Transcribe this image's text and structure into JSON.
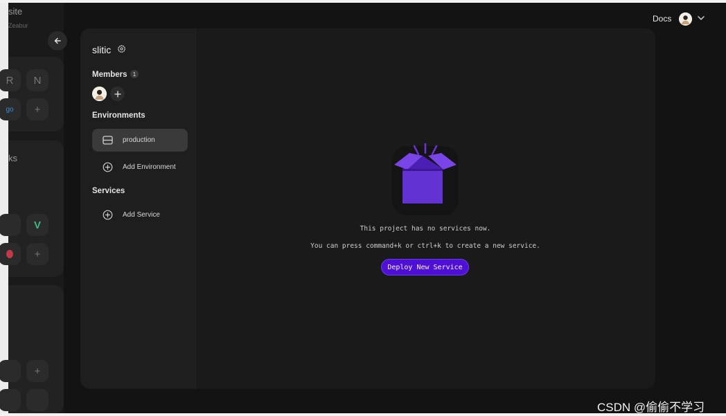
{
  "background": {
    "partial_site_label": "site",
    "partial_zeabur_label": "Zeabur",
    "partial_works_label": "ks",
    "tile_r": "R",
    "tile_n": "N",
    "tile_go": "go",
    "tile_v": "V",
    "tile_plus": "+"
  },
  "topbar": {
    "docs_label": "Docs"
  },
  "project": {
    "name": "slitic",
    "members_label": "Members",
    "members_count": "1",
    "environments_label": "Environments",
    "environments": [
      {
        "label": "production"
      }
    ],
    "add_environment_label": "Add Environment",
    "services_label": "Services",
    "add_service_label": "Add Service"
  },
  "empty_state": {
    "title": "This project has no services now.",
    "hint": "You can press command+k or ctrl+k to create a new service.",
    "deploy_label": "Deploy New Service"
  },
  "watermark": "CSDN @偷偷不学习",
  "colors": {
    "accent": "#4f10d6",
    "box_purple": "#6a35d8",
    "background": "#131313"
  },
  "icons": [
    "back-arrow-icon",
    "gear-icon",
    "plus-icon",
    "server-icon",
    "plus-circle-icon",
    "chevron-down-icon",
    "open-box-icon"
  ]
}
